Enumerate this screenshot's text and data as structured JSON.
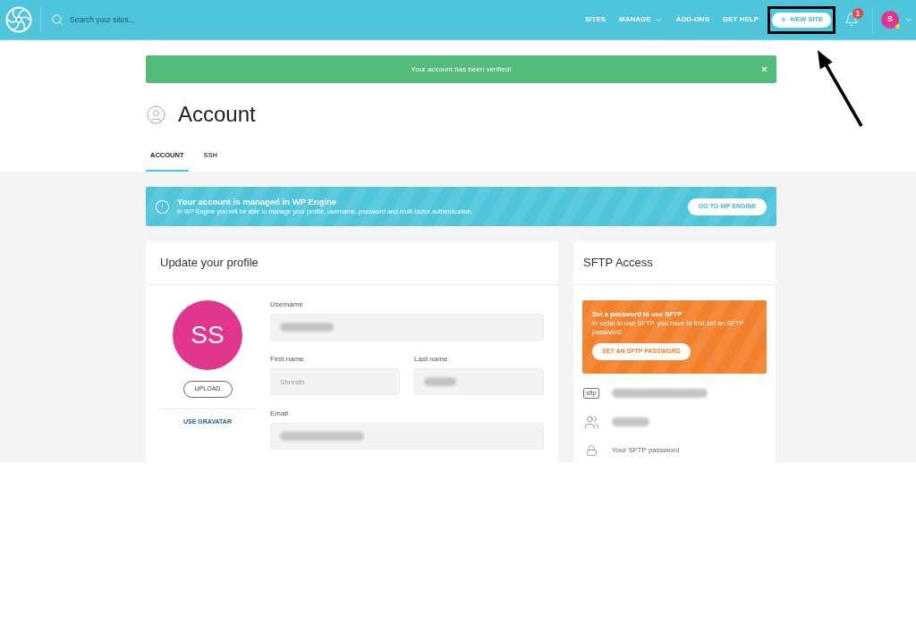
{
  "header": {
    "search": {
      "placeholder": "Search your sites..."
    },
    "nav": [
      {
        "label": "SITES",
        "kind": "link"
      },
      {
        "label": "MANAGE",
        "kind": "dropdown"
      },
      {
        "label": "ADD-ONS",
        "kind": "link"
      },
      {
        "label": "GET HELP",
        "kind": "link"
      }
    ],
    "new_site_button": {
      "label": "NEW SITE",
      "highlighted": true
    },
    "notifications": {
      "count": "1"
    },
    "user_menu": {
      "initial": "S"
    }
  },
  "alert": {
    "message": "Your account has been verified!"
  },
  "page": {
    "title": "Account"
  },
  "tabs": [
    {
      "label": "ACCOUNT",
      "selected": true
    },
    {
      "label": "SSH",
      "selected": false
    }
  ],
  "notice": {
    "title": "Your account is managed in WP Engine",
    "text": "In WP Engine you will be able to manage your profile, username, password and multi-factor authentication.",
    "button": "GO TO WP ENGINE"
  },
  "profile_card": {
    "title": "Update your profile",
    "avatar_initials": "SS",
    "upload_button": "UPLOAD",
    "gravatar_link": "USE GRAVATAR",
    "field_rows": [
      [
        {
          "label": "Username",
          "redacted": true
        }
      ],
      [
        {
          "label": "First name",
          "value": "Shresth"
        },
        {
          "label": "Last name",
          "redacted": true
        }
      ],
      [
        {
          "label": "Email",
          "redacted": true
        }
      ]
    ]
  },
  "sftp_card": {
    "title": "SFTP Access",
    "warning": {
      "title": "Set a password to use SFTP",
      "text": "In order to use SFTP, you have to first set an SFTP password.",
      "button": "SET AN SFTP PASSWORD"
    },
    "details": [
      {
        "kind": "host",
        "icon_label": "sftp",
        "redacted": true
      },
      {
        "kind": "user",
        "redacted": true
      },
      {
        "kind": "password",
        "text": "Your SFTP password"
      }
    ]
  }
}
